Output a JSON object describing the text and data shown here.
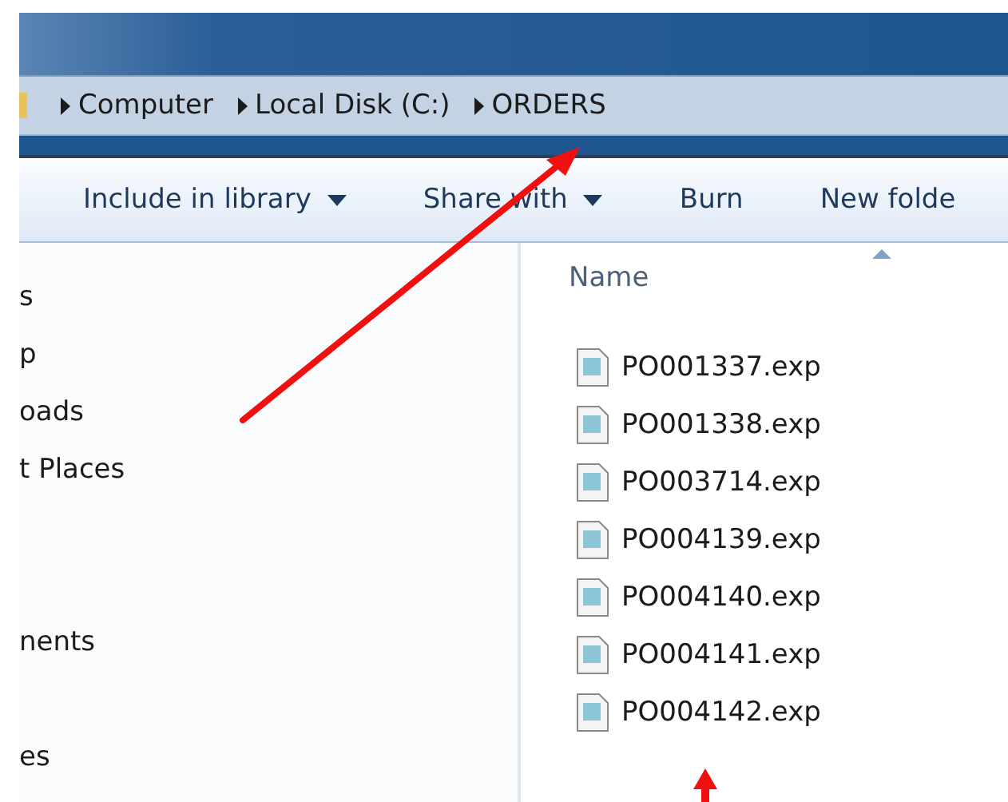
{
  "breadcrumb": [
    {
      "label": "Computer"
    },
    {
      "label": "Local Disk (C:)"
    },
    {
      "label": "ORDERS"
    }
  ],
  "toolbar": [
    {
      "label": "Include in library",
      "dropdown": true
    },
    {
      "label": "Share with",
      "dropdown": true
    },
    {
      "label": "Burn",
      "dropdown": false
    },
    {
      "label": "New folde",
      "dropdown": false
    }
  ],
  "nav_groups": [
    {
      "items": [
        "s",
        "p",
        "oads",
        "t Places"
      ]
    },
    {
      "items": [
        "nents"
      ]
    },
    {
      "items": [
        "es"
      ]
    }
  ],
  "file_list": {
    "column": "Name",
    "files": [
      "PO001337.exp",
      "PO001338.exp",
      "PO003714.exp",
      "PO004139.exp",
      "PO004140.exp",
      "PO004141.exp",
      "PO004142.exp"
    ]
  },
  "annotations": [
    {
      "kind": "arrow"
    },
    {
      "kind": "arrow"
    }
  ]
}
